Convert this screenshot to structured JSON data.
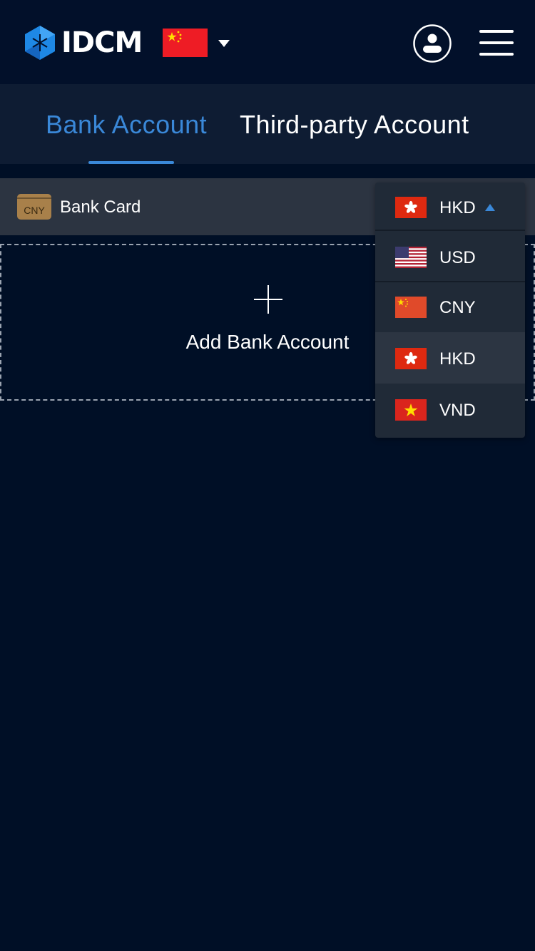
{
  "header": {
    "logo_text": "IDCM",
    "language_flag": "china-flag-icon",
    "icons": [
      "logo-icon",
      "caret-down-icon",
      "user-icon",
      "menu-icon"
    ]
  },
  "tabs": [
    {
      "label": "Bank Account",
      "active": true
    },
    {
      "label": "Third-party Account",
      "active": false
    }
  ],
  "bank_card": {
    "icon_text": "CNY",
    "label": "Bank Card"
  },
  "add_account": {
    "label": "Add Bank Account"
  },
  "currency_dropdown": {
    "selected": "HKD",
    "options": [
      {
        "code": "USD",
        "flag": "us-flag-icon"
      },
      {
        "code": "CNY",
        "flag": "china-flag-icon"
      },
      {
        "code": "HKD",
        "flag": "hk-flag-icon",
        "highlighted": true
      },
      {
        "code": "VND",
        "flag": "vietnam-flag-icon"
      }
    ]
  },
  "colors": {
    "background": "#000f26",
    "accent": "#3a88d8",
    "card_bar": "#2c3441",
    "dropdown": "#202a37"
  }
}
